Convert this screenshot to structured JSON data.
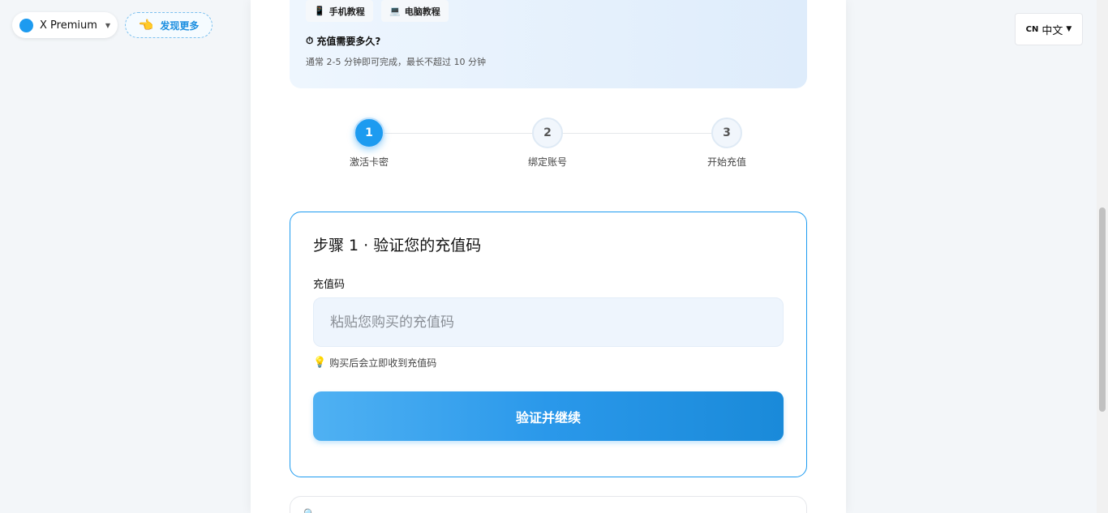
{
  "topbar": {
    "product_name": "X Premium",
    "discover_label": "发现更多",
    "lang_flag": "CN",
    "lang_label": "中文",
    "accent_color": "#1d9bf0"
  },
  "tutorial": {
    "phone_label": "手机教程",
    "pc_label": "电脑教程",
    "faq_title": "充值需要多久?",
    "faq_desc": "通常 2-5 分钟即可完成，最长不超过 10 分钟"
  },
  "steps": [
    {
      "number": "1",
      "label": "激活卡密",
      "active": true
    },
    {
      "number": "2",
      "label": "绑定账号",
      "active": false
    },
    {
      "number": "3",
      "label": "开始充值",
      "active": false
    }
  ],
  "form": {
    "title": "步骤 1 · 验证您的充值码",
    "field_label": "充值码",
    "input_value": "",
    "input_placeholder": "粘贴您购买的充值码",
    "hint": "购买后会立即收到充值码",
    "submit_label": "验证并继续"
  }
}
